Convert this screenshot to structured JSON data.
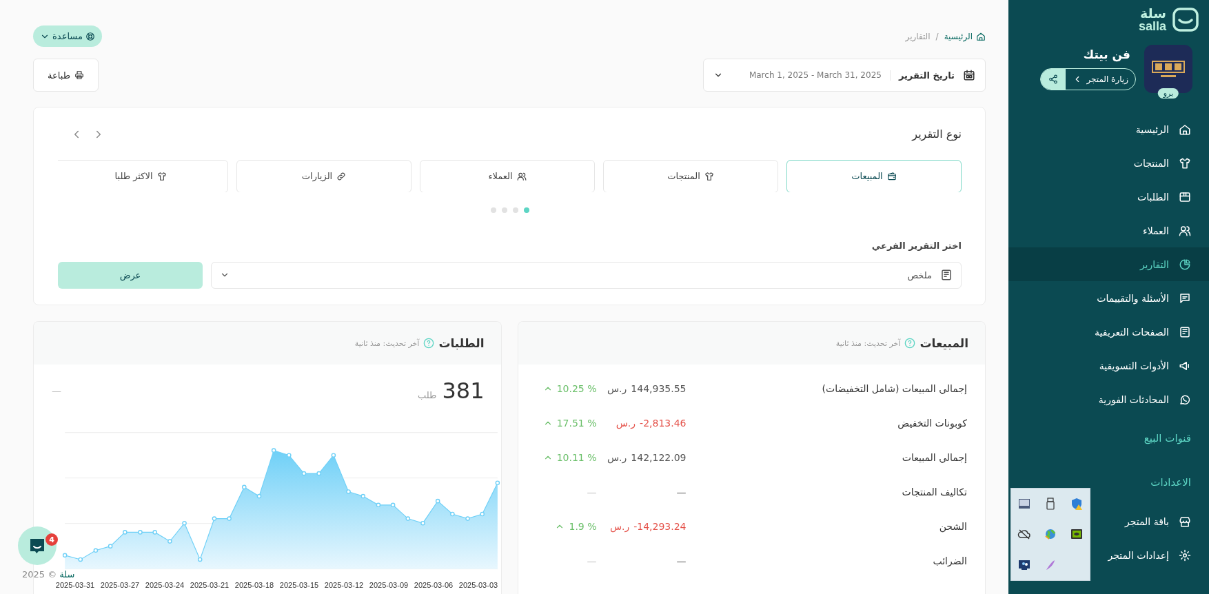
{
  "breadcrumb": {
    "items": [
      {
        "label": "الرئيسية"
      },
      {
        "label": "التقارير"
      }
    ],
    "separator": "/"
  },
  "help_button": {
    "label": "مساعدة"
  },
  "date_filter": {
    "label": "تاريخ التقرير",
    "value": "March 1, 2025 - March 31, 2025"
  },
  "print_button": {
    "label": "طباعة"
  },
  "report_type": {
    "title": "نوع التقرير",
    "tabs": [
      {
        "label": "المبيعات",
        "selected": true
      },
      {
        "label": "المنتجات",
        "selected": false
      },
      {
        "label": "العملاء",
        "selected": false
      },
      {
        "label": "الزيارات",
        "selected": false
      },
      {
        "label": "الاكثر طلبا",
        "selected": false
      }
    ],
    "pager": [
      {
        "selected": true
      },
      {
        "selected": false
      },
      {
        "selected": false
      },
      {
        "selected": false
      }
    ]
  },
  "sub_report": {
    "label": "اختر التقرير الفرعي",
    "value": "ملخص",
    "button": "عرض"
  },
  "sales_card": {
    "title": "المبيعات",
    "updated": "آخر تحديث: منذ ثانية",
    "rows": [
      {
        "label": "إجمالي المبيعات (شامل التخفيضات)",
        "value": "144,935.55",
        "currency": "ر.س",
        "negative": false,
        "change": "10.25 %",
        "rising": true
      },
      {
        "label": "كوبونات التخفيض",
        "value": "-2,813.46",
        "currency": "ر.س",
        "negative": true,
        "change": "17.51 %",
        "rising": true
      },
      {
        "label": "إجمالي المبيعات",
        "value": "142,122.09",
        "currency": "ر.س",
        "negative": false,
        "change": "10.11 %",
        "rising": true
      },
      {
        "label": "تكاليف المنتجات",
        "value": "—",
        "negative": false,
        "change": "—",
        "rising": false
      },
      {
        "label": "الشحن",
        "value": "-14,293.24",
        "currency": "ر.س",
        "negative": true,
        "change": "1.9 %",
        "rising": true
      },
      {
        "label": "الضرائب",
        "value": "—",
        "negative": false,
        "change": "—",
        "rising": false
      }
    ]
  },
  "orders_card": {
    "title": "الطلبات",
    "updated": "آخر تحديث: منذ ثانية",
    "total": "381",
    "unit": "طلب",
    "change": "—",
    "x_labels": [
      "2025-03-03",
      "2025-03-06",
      "2025-03-09",
      "2025-03-12",
      "2025-03-15",
      "2025-03-18",
      "2025-03-21",
      "2025-03-24",
      "2025-03-27",
      "2025-03-31"
    ]
  },
  "chat_widget": {
    "badge": "4"
  },
  "footer": {
    "brand": "سلة",
    "copyright": "© 2025"
  },
  "sidebar": {
    "brand": {
      "arabic": "سلة",
      "latin": "salla"
    },
    "store": {
      "name": "فن بيتك",
      "badge": "برو",
      "visit_label": "زيارة المتجر"
    },
    "nav": [
      {
        "kind": "item",
        "label": "الرئيسية",
        "selected": false
      },
      {
        "kind": "item",
        "label": "المنتجات",
        "selected": false
      },
      {
        "kind": "item",
        "label": "الطلبات",
        "selected": false
      },
      {
        "kind": "item",
        "label": "العملاء",
        "selected": false
      },
      {
        "kind": "item",
        "label": "التقارير",
        "selected": true
      },
      {
        "kind": "item",
        "label": "الأسئلة والتقييمات",
        "selected": false
      },
      {
        "kind": "item",
        "label": "الصفحات التعريفية",
        "selected": false
      },
      {
        "kind": "item",
        "label": "الأدوات التسويقية",
        "selected": false
      },
      {
        "kind": "item",
        "label": "المحادثات الفورية",
        "selected": false
      },
      {
        "kind": "section",
        "label": "قنوات البيع"
      },
      {
        "kind": "section",
        "label": "الاعدادات"
      },
      {
        "kind": "item",
        "label": "باقة المتجر",
        "selected": false
      },
      {
        "kind": "item",
        "label": "إعدادات المتجر",
        "selected": false
      }
    ]
  }
}
